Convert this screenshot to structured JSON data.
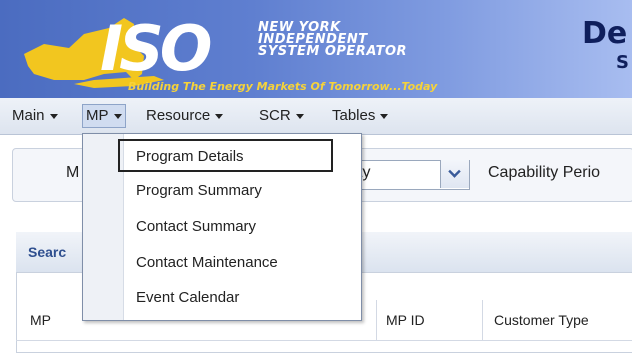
{
  "header": {
    "logo_letters": "ISO",
    "org_line1": "NEW YORK",
    "org_line2": "INDEPENDENT",
    "org_line3": "SYSTEM OPERATOR",
    "tagline": "Building The Energy Markets Of Tomorrow...Today",
    "title_partial": "De",
    "title_partial2": "S"
  },
  "menu": {
    "items": [
      {
        "label": "Main"
      },
      {
        "label": "MP"
      },
      {
        "label": "Resource"
      },
      {
        "label": "SCR"
      },
      {
        "label": "Tables"
      }
    ],
    "active": "MP"
  },
  "dropdown": {
    "items": [
      {
        "label": "Program Details"
      },
      {
        "label": "Program Summary"
      },
      {
        "label": "Contact Summary"
      },
      {
        "label": "Contact Maintenance"
      },
      {
        "label": "Event Calendar"
      }
    ],
    "highlighted": "Program Details"
  },
  "filters": {
    "label_partial": "M",
    "select_value_partial": "ty",
    "capability_label_partial": "Capability Perio"
  },
  "panel": {
    "title_partial": "Searc",
    "columns": [
      "MP",
      "MP ID",
      "Customer Type"
    ]
  },
  "colors": {
    "banner": "#5f7fd0",
    "tagline": "#f6d33a",
    "title": "#0f1f5c",
    "panel_title": "#2f4f8f"
  }
}
